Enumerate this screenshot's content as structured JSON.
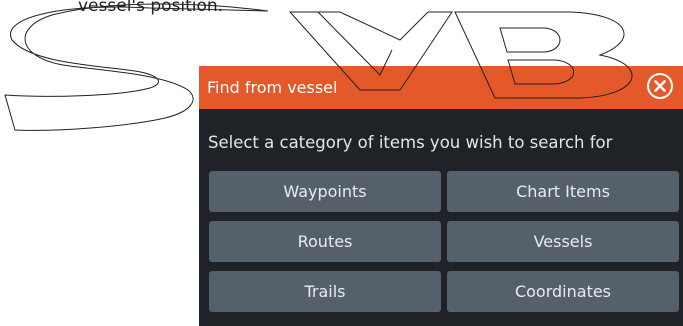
{
  "intro": {
    "text": "vessel's position."
  },
  "dialog": {
    "title": "Find from vessel",
    "prompt": "Select a category of items you wish to search for",
    "buttons": [
      {
        "label": "Waypoints"
      },
      {
        "label": "Chart Items"
      },
      {
        "label": "Routes"
      },
      {
        "label": "Vessels"
      },
      {
        "label": "Trails"
      },
      {
        "label": "Coordinates"
      }
    ],
    "close_icon": "close-circle-icon"
  },
  "watermark": {
    "text": "SVB"
  },
  "colors": {
    "header": "#e4582a",
    "dialog_bg": "#1f2226",
    "button_bg": "#56606b"
  }
}
